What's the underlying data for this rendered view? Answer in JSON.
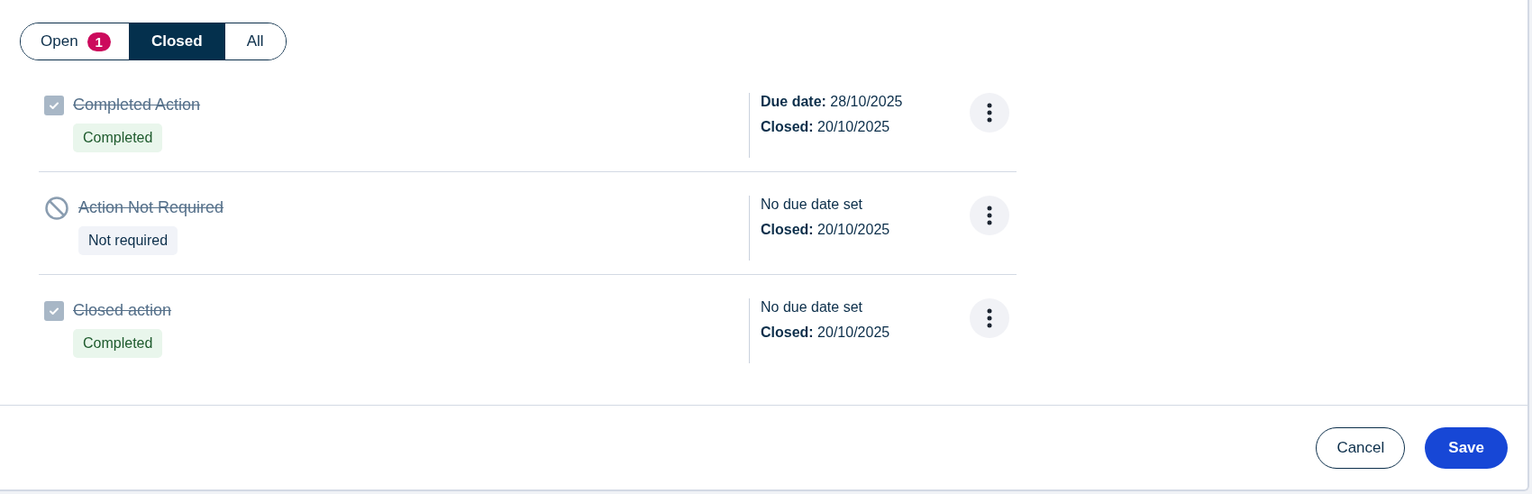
{
  "tabs": [
    {
      "label": "Open",
      "count": "1",
      "selected": false
    },
    {
      "label": "Closed",
      "selected": true
    },
    {
      "label": "All",
      "selected": false
    }
  ],
  "actions": [
    {
      "kind": "checkbox",
      "checked": true,
      "title": "Completed Action",
      "closed": true,
      "status": {
        "kind": "completed",
        "label": "Completed"
      },
      "meta": [
        "**Due date:** 28/10/2025",
        "**Closed:** 20/10/2025"
      ]
    },
    {
      "kind": "not_required",
      "title": "Action Not Required",
      "closed": true,
      "status": {
        "kind": "not_required",
        "label": "Not required"
      },
      "meta": [
        "No due date set",
        "**Closed:** 20/10/2025"
      ]
    },
    {
      "kind": "checkbox",
      "checked": true,
      "title": "Closed action",
      "closed": true,
      "status": {
        "kind": "completed",
        "label": "Completed"
      },
      "meta": [
        "No due date set",
        "**Closed:** 20/10/2025"
      ]
    }
  ],
  "footer": {
    "cancel": "Cancel",
    "save": "Save"
  }
}
